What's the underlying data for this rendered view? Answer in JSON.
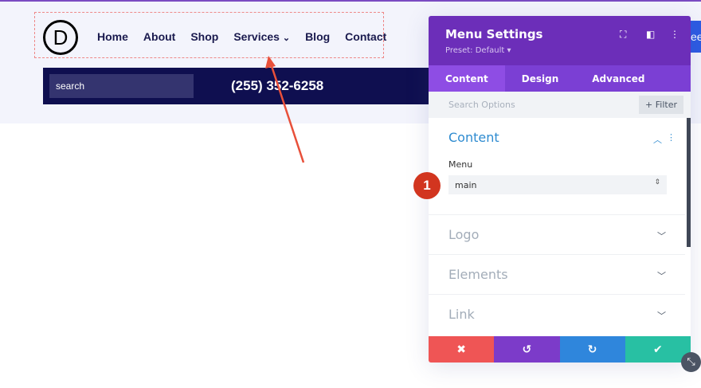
{
  "site": {
    "logo_letter": "D",
    "nav": [
      "Home",
      "About",
      "Shop",
      "Services",
      "Blog",
      "Contact"
    ],
    "services_chevron": "⌄",
    "search_placeholder": "search",
    "phone": "(255) 352-6258",
    "cta_partial": "ee"
  },
  "panel": {
    "title": "Menu Settings",
    "preset": "Preset: Default ▾",
    "tabs": [
      "Content",
      "Design",
      "Advanced"
    ],
    "search_placeholder": "Search Options",
    "filter_label": "+ Filter",
    "content_section": {
      "title": "Content",
      "menu_label": "Menu",
      "menu_value": "main"
    },
    "sections": [
      "Logo",
      "Elements",
      "Link"
    ],
    "footer": {
      "cancel": "✖",
      "undo": "↺",
      "redo": "↻",
      "save": "✔"
    },
    "colors": {
      "header": "#6c2eb9",
      "cancel": "#ef5555",
      "undo": "#7c3bc9",
      "redo": "#2f86dc",
      "save": "#28c0a3"
    }
  },
  "annotation": {
    "step": "1"
  }
}
